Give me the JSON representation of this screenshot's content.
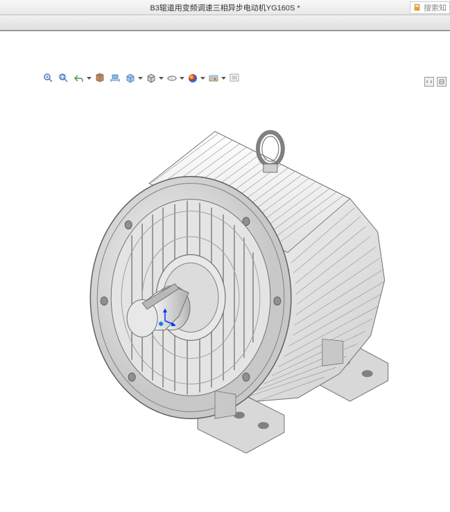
{
  "titlebar": {
    "document_title": "B3辊道用变频调速三相异步电动机YG160S *"
  },
  "search": {
    "placeholder": "搜索知"
  },
  "toolbar": {
    "icons": [
      {
        "name": "zoom-fit-icon",
        "title": "缩放到适合"
      },
      {
        "name": "zoom-area-icon",
        "title": "局部放大"
      },
      {
        "name": "previous-view-icon",
        "title": "上一视图"
      },
      {
        "name": "section-view-icon",
        "title": "剖面视图"
      },
      {
        "name": "dynamic-annotation-icon",
        "title": "动态注释"
      },
      {
        "name": "view-orientation-icon",
        "title": "视图定向"
      },
      {
        "name": "display-style-icon",
        "title": "显示样式"
      },
      {
        "name": "hide-show-icon",
        "title": "隐藏/显示"
      },
      {
        "name": "edit-appearance-icon",
        "title": "编辑外观"
      },
      {
        "name": "scene-icon",
        "title": "应用布景"
      },
      {
        "name": "view-settings-icon",
        "title": "视图设置"
      }
    ]
  },
  "right_controls": {
    "box1": "□",
    "box2": "□"
  },
  "model": {
    "description": "三相异步电动机 3D模型",
    "origin_label": "原点"
  }
}
